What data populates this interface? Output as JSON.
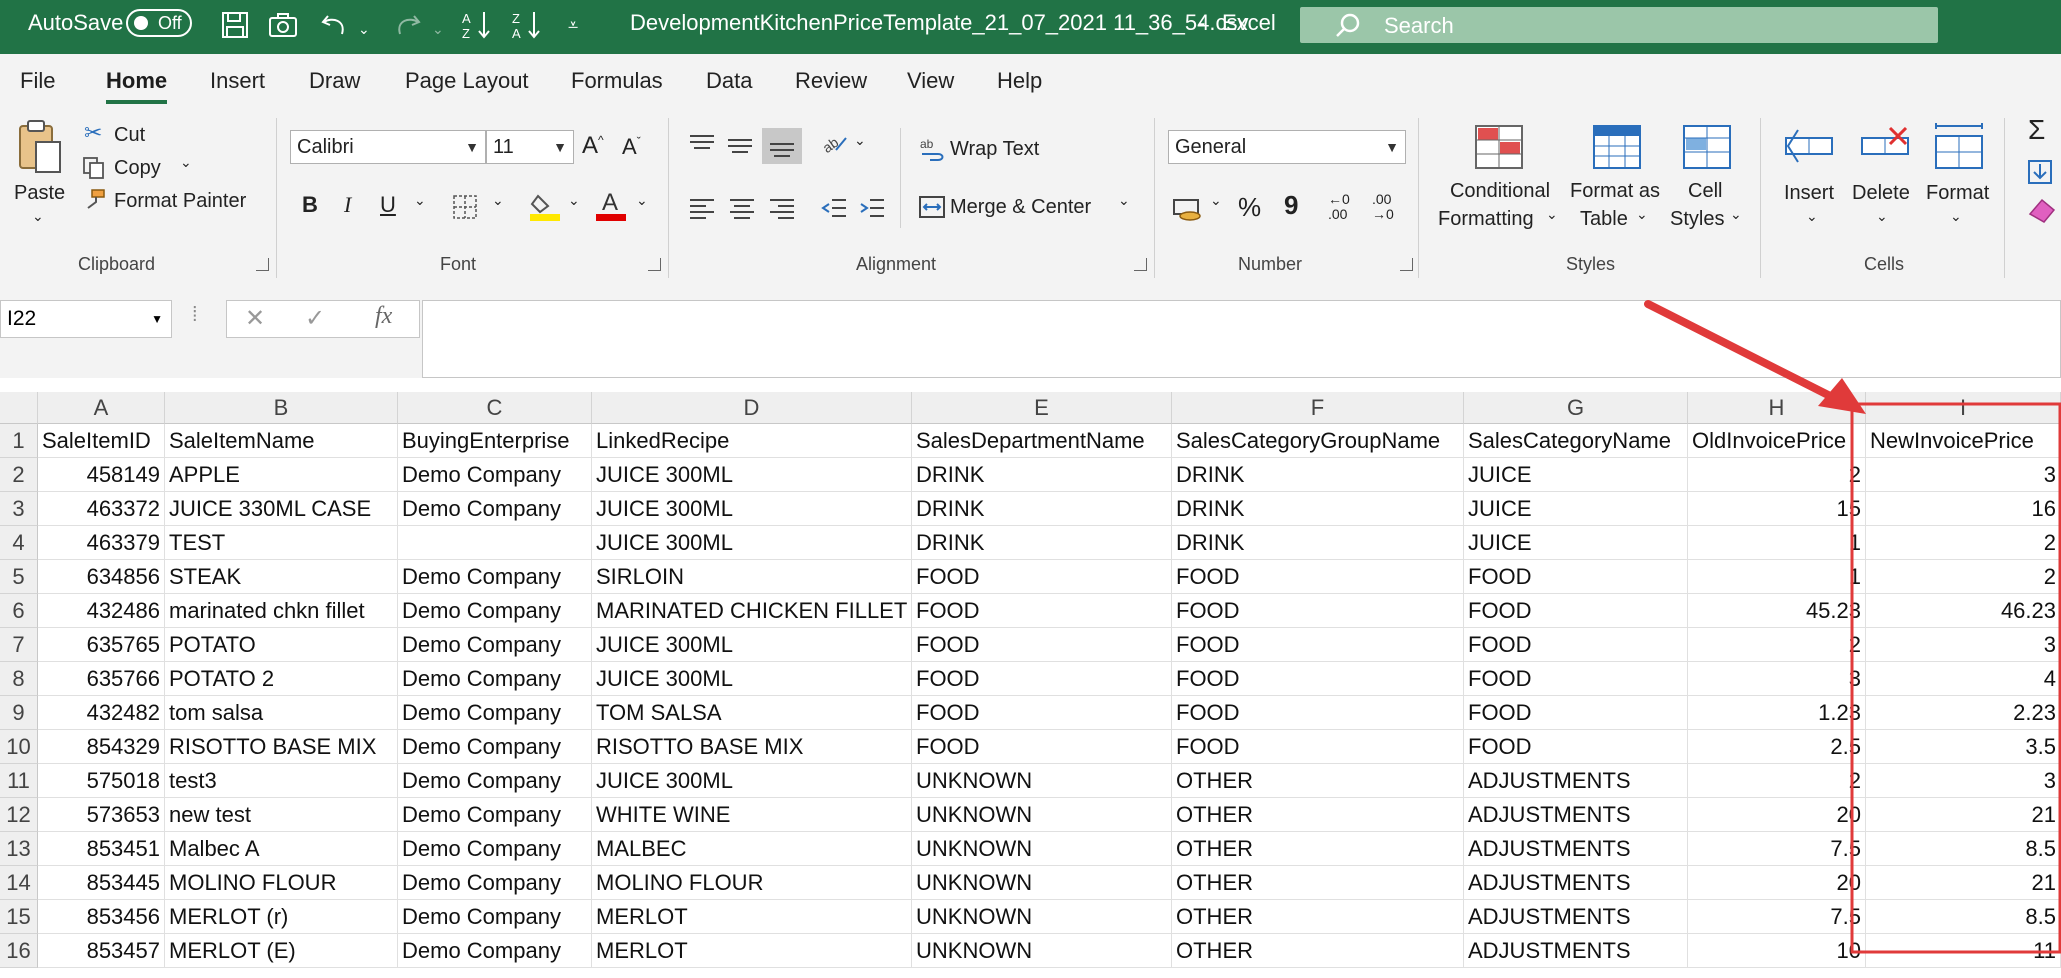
{
  "titlebar": {
    "autosave_label": "AutoSave",
    "autosave_state": "Off",
    "filename": "DevelopmentKitchenPriceTemplate_21_07_2021 11_36_54.csv",
    "separator": "-",
    "app": "Excel",
    "search_label": "Search"
  },
  "menu": {
    "tabs": [
      "File",
      "Home",
      "Insert",
      "Draw",
      "Page Layout",
      "Formulas",
      "Data",
      "Review",
      "View",
      "Help"
    ],
    "active": "Home"
  },
  "ribbon": {
    "clipboard": {
      "paste": "Paste",
      "cut": "Cut",
      "copy": "Copy",
      "format_painter": "Format Painter",
      "label": "Clipboard"
    },
    "font": {
      "family": "Calibri",
      "size": "11",
      "bold": "B",
      "italic": "I",
      "underline": "U",
      "label": "Font",
      "highlight_color": "#ffe800",
      "font_color": "#e00000"
    },
    "alignment": {
      "wrap": "Wrap Text",
      "merge": "Merge & Center",
      "label": "Alignment"
    },
    "number": {
      "format": "General",
      "percent": "%",
      "comma": "9",
      "inc_dec": "←0 .00",
      "dec_dec": ".00 →0",
      "label": "Number"
    },
    "styles": {
      "cond1": "Conditional",
      "cond2": "Formatting",
      "fmt1": "Format as",
      "fmt2": "Table",
      "cell1": "Cell",
      "cell2": "Styles",
      "label": "Styles"
    },
    "cells": {
      "insert": "Insert",
      "delete": "Delete",
      "format": "Format",
      "label": "Cells"
    }
  },
  "formula_bar": {
    "name_box": "I22",
    "fx": "fx",
    "formula": ""
  },
  "accent_color": "#217346",
  "annotation_color": "#e03a3a",
  "sheet": {
    "columns": [
      "A",
      "B",
      "C",
      "D",
      "E",
      "F",
      "G",
      "H",
      "I"
    ],
    "rows": [
      "1",
      "2",
      "3",
      "4",
      "5",
      "6",
      "7",
      "8",
      "9",
      "10",
      "11",
      "12",
      "13",
      "14",
      "15",
      "16"
    ],
    "header": [
      "SaleItemID",
      "SaleItemName",
      "BuyingEnterprise",
      "LinkedRecipe",
      "SalesDepartmentName",
      "SalesCategoryGroupName",
      "SalesCategoryName",
      "OldInvoicePrice",
      "NewInvoicePrice"
    ],
    "data": [
      [
        "458149",
        "APPLE",
        "Demo Company",
        "JUICE 300ML",
        "DRINK",
        "DRINK",
        "JUICE",
        "2",
        "3"
      ],
      [
        "463372",
        "JUICE 330ML CASE",
        "Demo Company",
        "JUICE 300ML",
        "DRINK",
        "DRINK",
        "JUICE",
        "15",
        "16"
      ],
      [
        "463379",
        "TEST",
        "",
        "JUICE 300ML",
        "DRINK",
        "DRINK",
        "JUICE",
        "1",
        "2"
      ],
      [
        "634856",
        "STEAK",
        "Demo Company",
        "SIRLOIN",
        "FOOD",
        "FOOD",
        "FOOD",
        "1",
        "2"
      ],
      [
        "432486",
        "marinated chkn fillet",
        "Demo Company",
        "MARINATED CHICKEN FILLET",
        "FOOD",
        "FOOD",
        "FOOD",
        "45.23",
        "46.23"
      ],
      [
        "635765",
        "POTATO",
        "Demo Company",
        "JUICE 300ML",
        "FOOD",
        "FOOD",
        "FOOD",
        "2",
        "3"
      ],
      [
        "635766",
        "POTATO 2",
        "Demo Company",
        "JUICE 300ML",
        "FOOD",
        "FOOD",
        "FOOD",
        "3",
        "4"
      ],
      [
        "432482",
        "tom salsa",
        "Demo Company",
        "TOM SALSA",
        "FOOD",
        "FOOD",
        "FOOD",
        "1.23",
        "2.23"
      ],
      [
        "854329",
        "RISOTTO BASE MIX",
        "Demo Company",
        "RISOTTO BASE MIX",
        "FOOD",
        "FOOD",
        "FOOD",
        "2.5",
        "3.5"
      ],
      [
        "575018",
        "test3",
        "Demo Company",
        "JUICE 300ML",
        "UNKNOWN",
        "OTHER",
        "ADJUSTMENTS",
        "2",
        "3"
      ],
      [
        "573653",
        "new test",
        "Demo Company",
        "WHITE WINE",
        "UNKNOWN",
        "OTHER",
        "ADJUSTMENTS",
        "20",
        "21"
      ],
      [
        "853451",
        "Malbec A",
        "Demo Company",
        "MALBEC",
        "UNKNOWN",
        "OTHER",
        "ADJUSTMENTS",
        "7.5",
        "8.5"
      ],
      [
        "853445",
        "MOLINO FLOUR",
        "Demo Company",
        "MOLINO FLOUR",
        "UNKNOWN",
        "OTHER",
        "ADJUSTMENTS",
        "20",
        "21"
      ],
      [
        "853456",
        "MERLOT (r)",
        "Demo Company",
        "MERLOT",
        "UNKNOWN",
        "OTHER",
        "ADJUSTMENTS",
        "7.5",
        "8.5"
      ],
      [
        "853457",
        "MERLOT (E)",
        "Demo Company",
        "MERLOT",
        "UNKNOWN",
        "OTHER",
        "ADJUSTMENTS",
        "10",
        "11"
      ]
    ],
    "numeric_columns": [
      0,
      7,
      8
    ]
  }
}
